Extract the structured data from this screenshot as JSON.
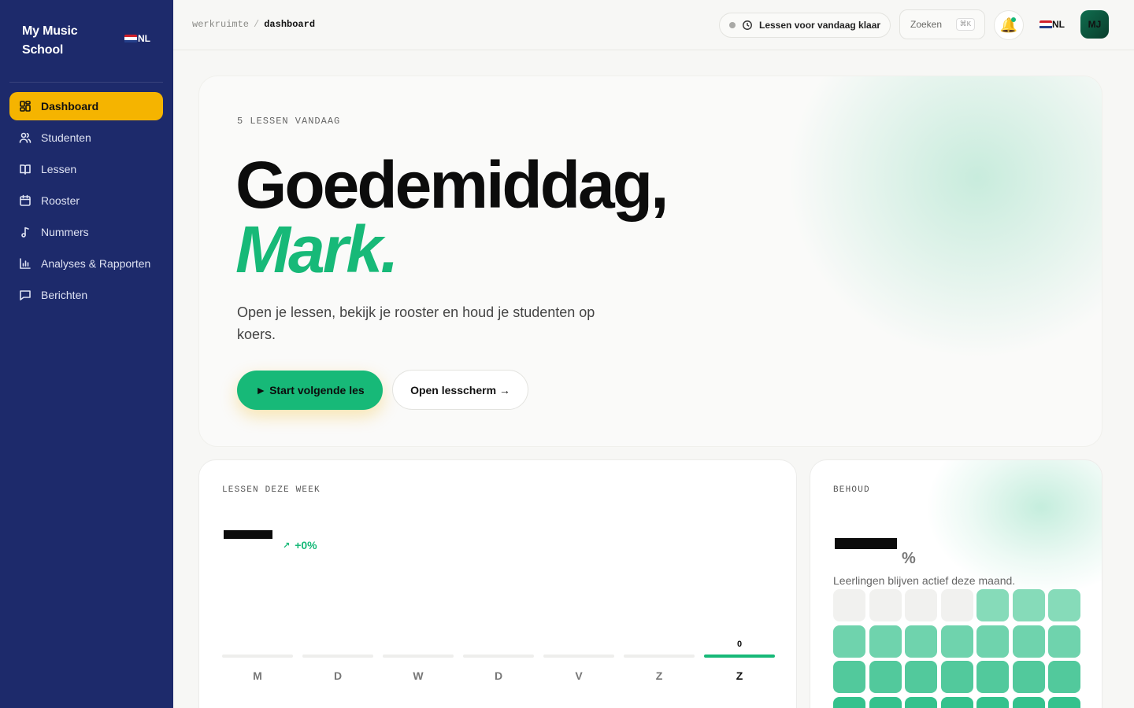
{
  "sidebar": {
    "brand": "My Music School",
    "lang": "NL",
    "items": [
      {
        "label": "Dashboard",
        "icon": "dashboard-icon",
        "active": true
      },
      {
        "label": "Studenten",
        "icon": "users-icon"
      },
      {
        "label": "Lessen",
        "icon": "book-icon"
      },
      {
        "label": "Rooster",
        "icon": "calendar-icon"
      },
      {
        "label": "Nummers",
        "icon": "music-note-icon"
      },
      {
        "label": "Analyses & Rapporten",
        "icon": "bar-chart-icon"
      },
      {
        "label": "Berichten",
        "icon": "message-icon"
      }
    ]
  },
  "topbar": {
    "breadcrumb": [
      "werkruimte",
      "dashboard"
    ],
    "breadcrumb_sep": "/",
    "status": "Lessen voor vandaag klaar",
    "search_label": "Zoeken",
    "search_shortcut": "⌘K",
    "bell_icon": "🔔",
    "lang": "NL",
    "avatar_initials": "MJ"
  },
  "hero": {
    "eyebrow": "5 LESSEN VANDAAG",
    "greeting": "Goedemiddag,",
    "name": "Mark.",
    "description": "Open je lessen, bekijk je rooster en houd je studenten op koers.",
    "primary_button": "► Start volgende les",
    "secondary_button": "Open lesscherm →"
  },
  "week_card": {
    "label": "LESSEN DEZE WEEK",
    "trend": "+0%",
    "trend_icon": "↗",
    "days": [
      {
        "day": "M",
        "value": null
      },
      {
        "day": "D",
        "value": null
      },
      {
        "day": "W",
        "value": null
      },
      {
        "day": "D",
        "value": null
      },
      {
        "day": "V",
        "value": null
      },
      {
        "day": "Z",
        "value": null
      },
      {
        "day": "Z",
        "value": "0",
        "active": true
      }
    ]
  },
  "retention_card": {
    "label": "BEHOUD",
    "unit": "%",
    "description": "Leerlingen blijven actief deze maand.",
    "grid_levels": [
      0,
      0,
      0,
      0,
      1,
      1,
      1,
      2,
      2,
      2,
      2,
      2,
      2,
      2,
      3,
      3,
      3,
      3,
      3,
      3,
      3,
      4,
      4,
      4,
      4,
      4,
      4,
      4
    ],
    "level_colors": [
      "#f1f1ef",
      "#86dbb9",
      "#6fd3ad",
      "#52c99c",
      "#34c28d"
    ],
    "accent": "#17b978",
    "sidebar_bg": "#1d2a6b",
    "active_nav": "#f5b400"
  }
}
